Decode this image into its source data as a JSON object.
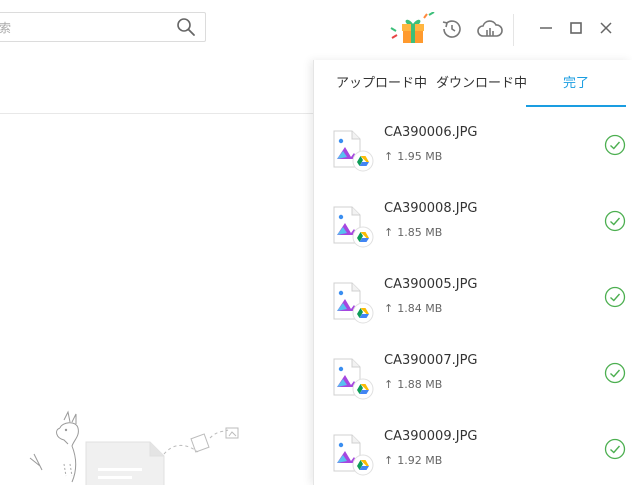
{
  "search": {
    "placeholder": "索"
  },
  "transfer": {
    "tabs": [
      {
        "label": "アップロード中"
      },
      {
        "label": "ダウンロード中"
      },
      {
        "label": "完了"
      }
    ],
    "size_arrow": "↑",
    "files": [
      {
        "name": "CA390006.JPG",
        "size": "1.95 MB",
        "status": "completed"
      },
      {
        "name": "CA390008.JPG",
        "size": "1.85 MB",
        "status": "completed"
      },
      {
        "name": "CA390005.JPG",
        "size": "1.84 MB",
        "status": "completed"
      },
      {
        "name": "CA390007.JPG",
        "size": "1.88 MB",
        "status": "completed"
      },
      {
        "name": "CA390009.JPG",
        "size": "1.92 MB",
        "status": "completed"
      }
    ]
  },
  "icons": {
    "search": "search-icon",
    "gift": "gift-icon",
    "history": "history-icon",
    "cloud": "cloud-icon",
    "file": "image-file-icon",
    "drive": "google-drive-icon",
    "check": "check-circle-icon"
  },
  "colors": {
    "accent": "#1a9de1",
    "success": "#4caf50",
    "icon_gray": "#777777"
  }
}
